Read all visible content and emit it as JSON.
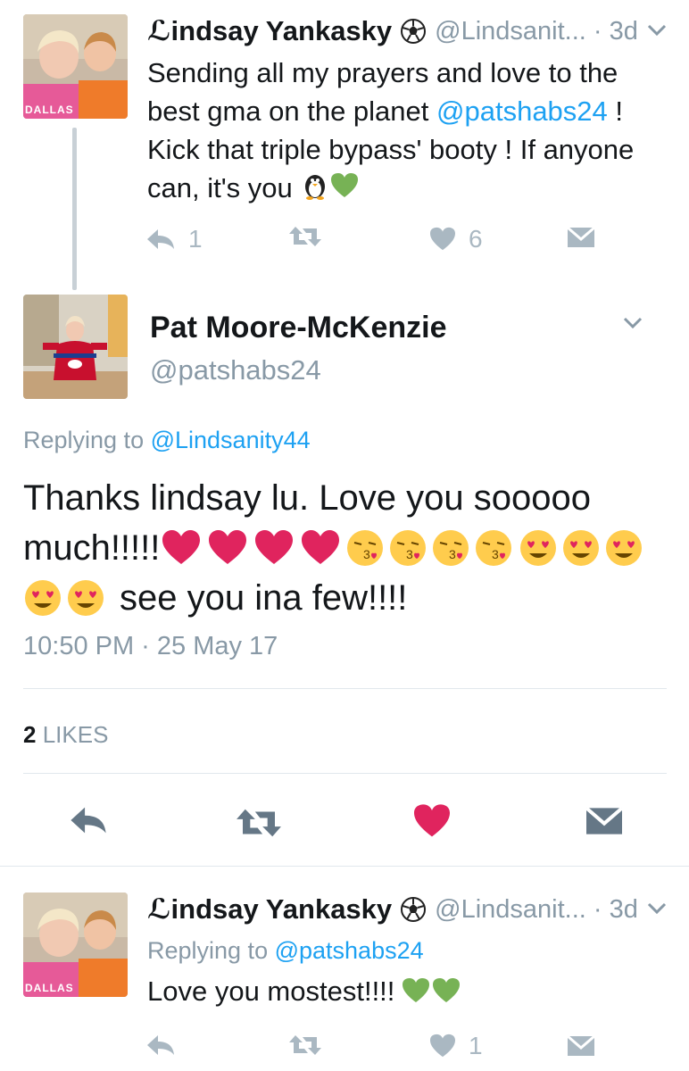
{
  "tweet1": {
    "name": "ℒindsay Yankasky",
    "handle": "@Lindsanit...",
    "time": "· 3d",
    "text_pre": "Sending all my prayers and love to the best gma on the planet ",
    "mention": "@patshabs24",
    "text_post": " ! Kick that triple bypass' booty ! If anyone can, it's you",
    "reply_count": "1",
    "like_count": "6",
    "avatar_text": "DALLAS"
  },
  "main_tweet": {
    "name": "Pat Moore-McKenzie",
    "handle": "@patshabs24",
    "replying_label": "Replying to ",
    "replying_to": "@Lindsanity44",
    "text_line1": "Thanks lindsay lu. Love you sooooo",
    "text_much": "much!!!!!",
    "text_end": "see you ina few!!!!",
    "timestamp": "10:50 PM · 25 May 17",
    "likes_count": "2",
    "likes_label": "LIKES"
  },
  "tweet3": {
    "name": "ℒindsay Yankasky",
    "handle": "@Lindsanit...",
    "time": "· 3d",
    "replying_label": "Replying to ",
    "replying_to": "@patshabs24",
    "text": "Love you mostest!!!!",
    "like_count": "1",
    "avatar_text": "DALLAS"
  },
  "colors": {
    "link": "#1da1f2",
    "icon_gray": "#aab8c2",
    "icon_dark": "#657786",
    "heart_liked": "#e0245e",
    "heart_green": "#77b255"
  }
}
